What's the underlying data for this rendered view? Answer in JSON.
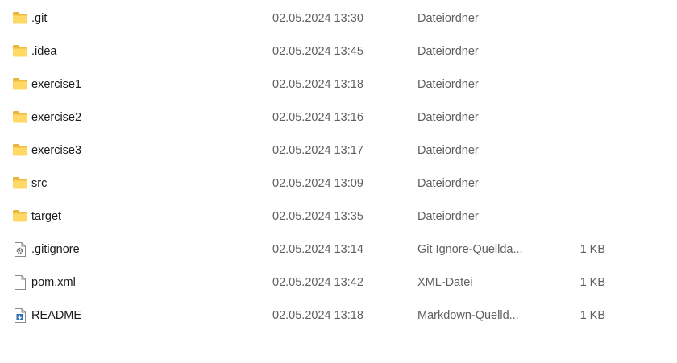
{
  "files": [
    {
      "name": ".git",
      "date": "02.05.2024 13:30",
      "type": "Dateiordner",
      "size": "",
      "icon": "folder-icon"
    },
    {
      "name": ".idea",
      "date": "02.05.2024 13:45",
      "type": "Dateiordner",
      "size": "",
      "icon": "folder-icon"
    },
    {
      "name": "exercise1",
      "date": "02.05.2024 13:18",
      "type": "Dateiordner",
      "size": "",
      "icon": "folder-icon"
    },
    {
      "name": "exercise2",
      "date": "02.05.2024 13:16",
      "type": "Dateiordner",
      "size": "",
      "icon": "folder-icon"
    },
    {
      "name": "exercise3",
      "date": "02.05.2024 13:17",
      "type": "Dateiordner",
      "size": "",
      "icon": "folder-icon"
    },
    {
      "name": "src",
      "date": "02.05.2024 13:09",
      "type": "Dateiordner",
      "size": "",
      "icon": "folder-icon"
    },
    {
      "name": "target",
      "date": "02.05.2024 13:35",
      "type": "Dateiordner",
      "size": "",
      "icon": "folder-icon"
    },
    {
      "name": ".gitignore",
      "date": "02.05.2024 13:14",
      "type": "Git Ignore-Quellda...",
      "size": "1 KB",
      "icon": "settings-file-icon"
    },
    {
      "name": "pom.xml",
      "date": "02.05.2024 13:42",
      "type": "XML-Datei",
      "size": "1 KB",
      "icon": "file-icon"
    },
    {
      "name": "README",
      "date": "02.05.2024 13:18",
      "type": "Markdown-Quelld...",
      "size": "1 KB",
      "icon": "markdown-file-icon"
    }
  ]
}
